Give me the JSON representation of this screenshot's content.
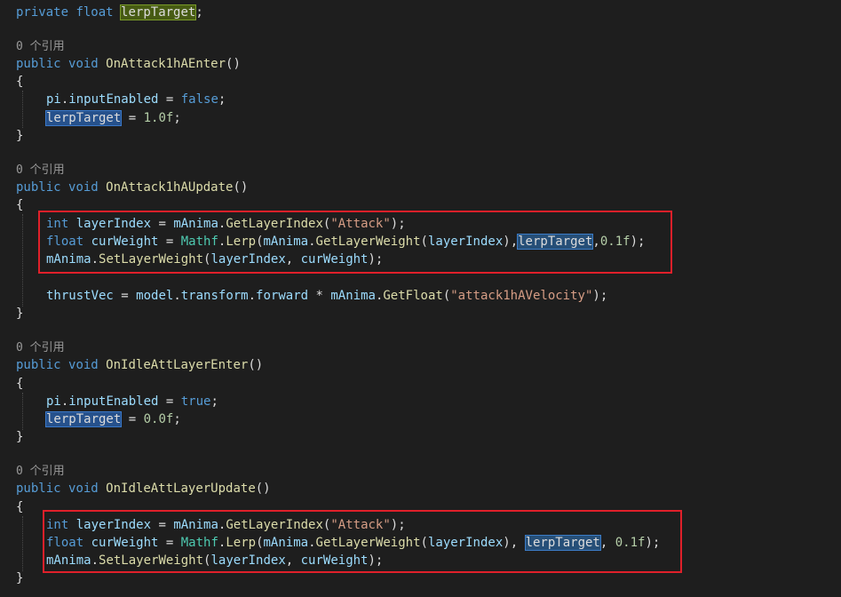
{
  "field": {
    "mod": "private",
    "type": "float",
    "name": "lerpTarget",
    "semi": ";"
  },
  "ref_label": "0 个引用",
  "colors": {
    "background": "#1e1e1e",
    "keyword": "#569cd6",
    "type": "#4ec9b0",
    "identifier": "#9cdcfe",
    "method": "#dcdcaa",
    "string": "#d69d85",
    "number": "#b5cea8",
    "highlight_box": "#e0202a"
  },
  "methods": [
    {
      "sig_mod": "public",
      "sig_ret": "void",
      "sig_name": "OnAttack1hAEnter",
      "sig_rest": "()",
      "open": "{",
      "close": "}",
      "l1_obj": "pi",
      "l1_dot": ".",
      "l1_prop": "inputEnabled",
      "l1_eq": " = ",
      "l1_val": "false",
      "l1_semi": ";",
      "l2_var": "lerpTarget",
      "l2_eq": " = ",
      "l2_val": "1.0f",
      "l2_semi": ";"
    },
    {
      "sig_mod": "public",
      "sig_ret": "void",
      "sig_name": "OnAttack1hAUpdate",
      "sig_rest": "()",
      "open": "{",
      "close": "}",
      "l1_type": "int",
      "l1_var": "layerIndex",
      "l1_eq": " = ",
      "l1_obj": "mAnima",
      "l1_dot": ".",
      "l1_fn": "GetLayerIndex",
      "l1_open": "(",
      "l1_str": "\"Attack\"",
      "l1_close": ");",
      "l2_type": "float",
      "l2_var": "curWeight",
      "l2_eq": " = ",
      "l2_cls": "Mathf",
      "l2_dot": ".",
      "l2_fn": "Lerp",
      "l2_open": "(",
      "l2_obj": "mAnima",
      "l2_dot2": ".",
      "l2_fn2": "GetLayerWeight",
      "l2_open2": "(",
      "l2_arg": "layerIndex",
      "l2_close2": "),",
      "l2_hl": "lerpTarget",
      "l2_comma": ",",
      "l2_num": "0.1f",
      "l2_close": ");",
      "l3_obj": "mAnima",
      "l3_dot": ".",
      "l3_fn": "SetLayerWeight",
      "l3_open": "(",
      "l3_arg1": "layerIndex",
      "l3_comma": ", ",
      "l3_arg2": "curWeight",
      "l3_close": ");",
      "l4_var": "thrustVec",
      "l4_eq": " = ",
      "l4_obj": "model",
      "l4_dot": ".",
      "l4_p1": "transform",
      "l4_dot2": ".",
      "l4_p2": "forward",
      "l4_mul": " * ",
      "l4_obj2": "mAnima",
      "l4_dot3": ".",
      "l4_fn": "GetFloat",
      "l4_open": "(",
      "l4_str": "\"attack1hAVelocity\"",
      "l4_close": ");"
    },
    {
      "sig_mod": "public",
      "sig_ret": "void",
      "sig_name": "OnIdleAttLayerEnter",
      "sig_rest": "()",
      "open": "{",
      "close": "}",
      "l1_obj": "pi",
      "l1_dot": ".",
      "l1_prop": "inputEnabled",
      "l1_eq": " = ",
      "l1_val": "true",
      "l1_semi": ";",
      "l2_var": "lerpTarget",
      "l2_eq": " = ",
      "l2_val": "0.0f",
      "l2_semi": ";"
    },
    {
      "sig_mod": "public",
      "sig_ret": "void",
      "sig_name": "OnIdleAttLayerUpdate",
      "sig_rest": "()",
      "open": "{",
      "close": "}",
      "l1_type": "int",
      "l1_var": "layerIndex",
      "l1_eq": " = ",
      "l1_obj": "mAnima",
      "l1_dot": ".",
      "l1_fn": "GetLayerIndex",
      "l1_open": "(",
      "l1_str": "\"Attack\"",
      "l1_close": ");",
      "l2_type": "float",
      "l2_var": "curWeight",
      "l2_eq": " = ",
      "l2_cls": "Mathf",
      "l2_dot": ".",
      "l2_fn": "Lerp",
      "l2_open": "(",
      "l2_obj": "mAnima",
      "l2_dot2": ".",
      "l2_fn2": "GetLayerWeight",
      "l2_open2": "(",
      "l2_arg": "layerIndex",
      "l2_close2": "), ",
      "l2_hl": "lerpTarget",
      "l2_comma": ", ",
      "l2_num": "0.1f",
      "l2_close": ");",
      "l3_obj": "mAnima",
      "l3_dot": ".",
      "l3_fn": "SetLayerWeight",
      "l3_open": "(",
      "l3_arg1": "layerIndex",
      "l3_comma": ", ",
      "l3_arg2": "curWeight",
      "l3_close": ");"
    }
  ]
}
